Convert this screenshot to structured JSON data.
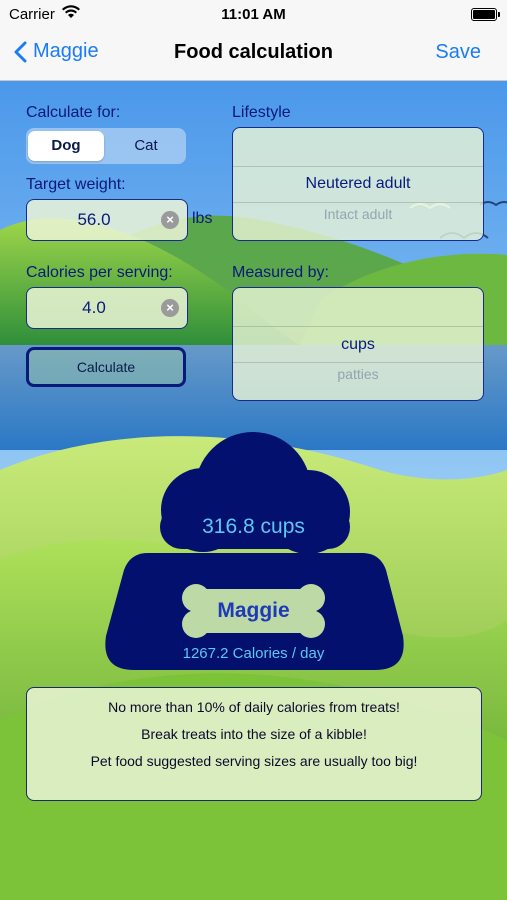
{
  "status_bar": {
    "carrier": "Carrier",
    "time": "11:01 AM"
  },
  "nav": {
    "back_label": "Maggie",
    "title": "Food calculation",
    "save_label": "Save"
  },
  "form": {
    "calculate_for_label": "Calculate for:",
    "segments": [
      "Dog",
      "Cat"
    ],
    "selected_segment": "Dog",
    "target_weight_label": "Target weight:",
    "target_weight_value": "56.0",
    "weight_unit": "lbs",
    "calories_label": "Calories per serving:",
    "calories_value": "4.0",
    "calculate_button": "Calculate",
    "lifestyle_label": "Lifestyle",
    "lifestyle_selected": "Neutered adult",
    "lifestyle_next": "Intact adult",
    "measured_by_label": "Measured by:",
    "measured_selected": "cups",
    "measured_next": "patties"
  },
  "result": {
    "amount": "316.8 cups",
    "pet_name": "Maggie",
    "calories": "1267.2 Calories / day"
  },
  "tips": [
    "No more than 10% of daily calories from treats!",
    "Break treats into the size of a kibble!",
    "Pet food suggested serving sizes are usually too big!"
  ],
  "colors": {
    "accent": "#1b7cf5",
    "navy": "#03106e",
    "sky": "#5aa8f0",
    "grass": "#7cc33a"
  }
}
